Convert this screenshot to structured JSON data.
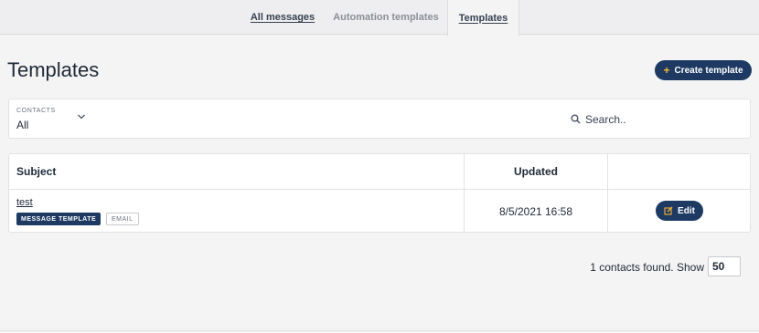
{
  "tabs": [
    {
      "label": "All messages",
      "state": "underlined"
    },
    {
      "label": "Automation templates",
      "state": "muted"
    },
    {
      "label": "Templates",
      "state": "active"
    }
  ],
  "page_title": "Templates",
  "create_button": {
    "label": "Create template",
    "icon": "plus-icon"
  },
  "filter": {
    "label": "CONTACTS",
    "value": "All",
    "search_placeholder": "Search.."
  },
  "table": {
    "headers": {
      "subject": "Subject",
      "updated": "Updated"
    },
    "rows": [
      {
        "subject": "test",
        "badges": [
          "MESSAGE TEMPLATE",
          "EMAIL"
        ],
        "updated": "8/5/2021 16:58",
        "edit_label": "Edit"
      }
    ]
  },
  "footer": {
    "count_text": "1 contacts found. Show",
    "page_size": "50"
  },
  "colors": {
    "primary": "#1e3a63",
    "accent": "#f5b335",
    "background": "#f4f4f5"
  }
}
